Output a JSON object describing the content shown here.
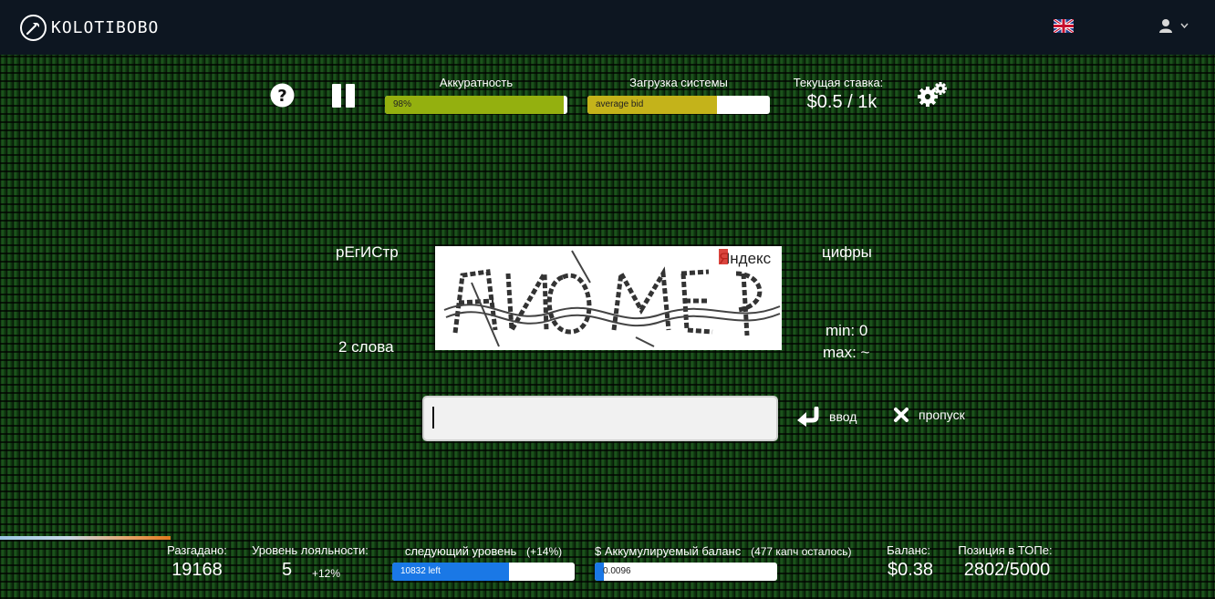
{
  "header": {
    "logo_text": "KOLOTIBOBO",
    "language_flag": "uk-flag-icon",
    "user_icon": "user-icon"
  },
  "controls": {
    "help_icon": "question-circle-icon",
    "pause_icon": "pause-icon",
    "settings_icon": "gears-icon"
  },
  "stats_top": {
    "accuracy_label": "Аккуратность",
    "accuracy_text": "98%",
    "accuracy_value": 0.98,
    "load_label": "Загрузка системы",
    "load_text": "average bid",
    "load_value": 0.71,
    "rate_label": "Текущая ставка:",
    "rate_value": "$0.5 / 1k"
  },
  "task": {
    "case_hint": "рЕгИСтр",
    "words_hint": "2 слова",
    "digits_hint": "цифры",
    "min_label": "min: 0",
    "max_label": "max: ~",
    "captcha_watermark": "Яндекс",
    "input_value": "",
    "input_placeholder": "",
    "submit_label": "ввод",
    "skip_label": "пропуск"
  },
  "stats_bottom": {
    "solved_label": "Разгадано:",
    "solved_value": "19168",
    "loyalty_label": "Уровень лояльности:",
    "loyalty_value": "5",
    "loyalty_bonus": "+12%",
    "next_level_label": "следующий уровень",
    "next_level_bonus": "(+14%)",
    "next_level_text": "10832 left",
    "next_level_value": 0.64,
    "accum_label": "$ Аккумулируемый баланс",
    "accum_note": "(477 капч осталось)",
    "accum_text": "0.0096",
    "accum_value": 0.05,
    "balance_label": "Баланс:",
    "balance_value": "$0.38",
    "top_label": "Позиция в ТОПе:",
    "top_value": "2802/5000"
  },
  "colors": {
    "accuracy_fill": "#94b00f",
    "load_fill": "#c4b31a",
    "level_fill": "#1a78e6",
    "topbar": "#0d1621"
  }
}
